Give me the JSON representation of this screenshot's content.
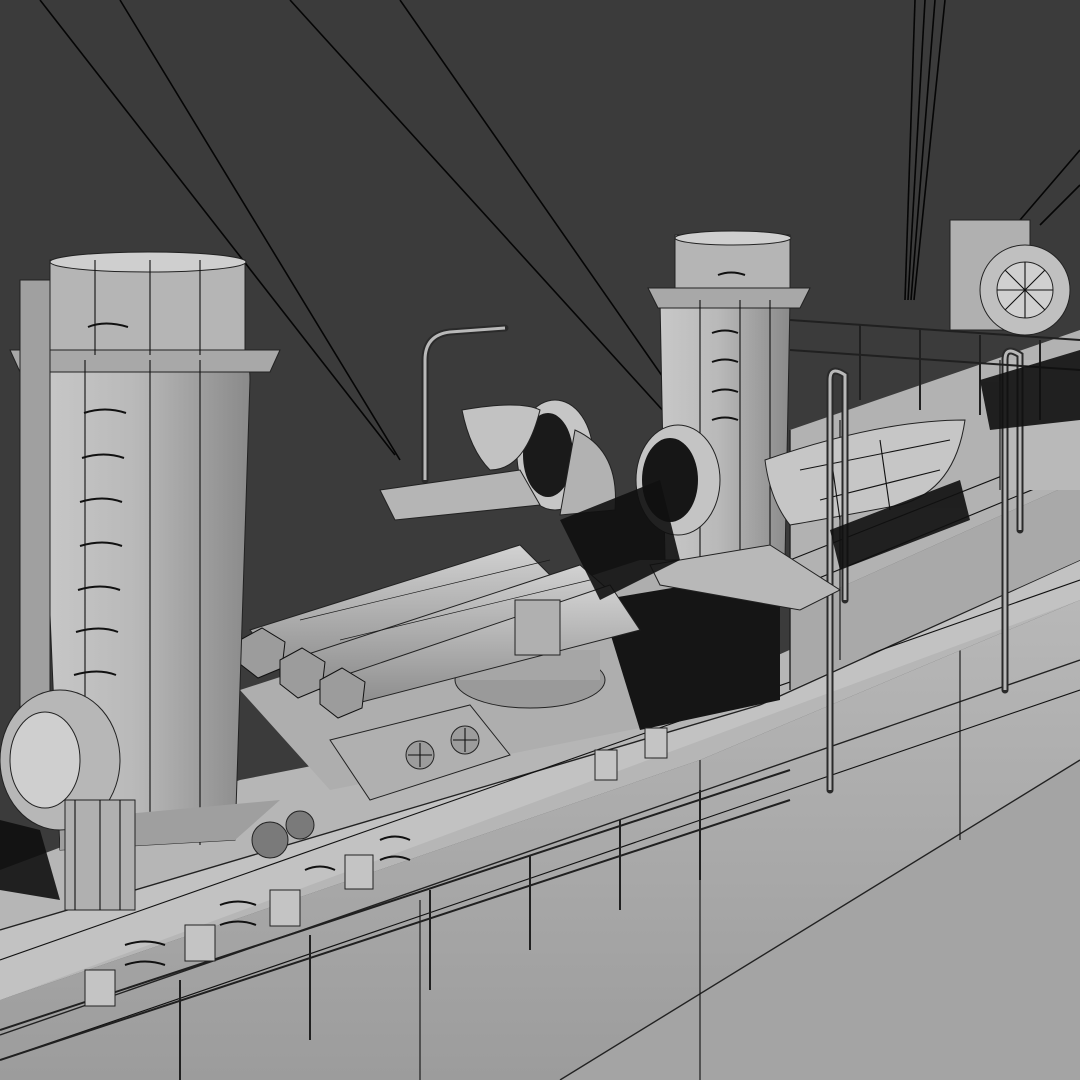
{
  "scene": {
    "background_color": "#3b3b3b",
    "model_base_color": "#b4b4b4",
    "model_shadow_color": "#111111",
    "wire_color": "#111111",
    "render_mode": "wireframe-on-shaded"
  }
}
